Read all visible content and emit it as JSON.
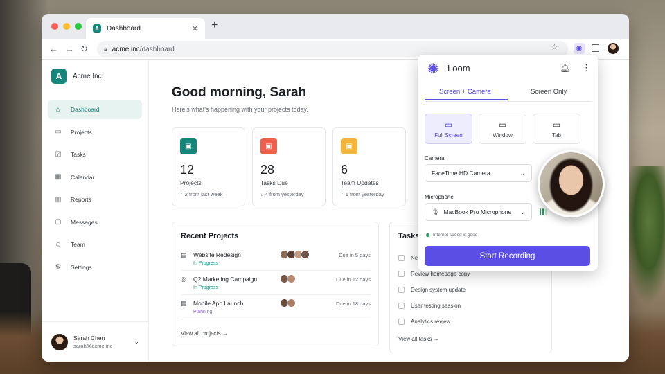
{
  "colors": {
    "brand": "#16857a",
    "loom_accent": "#5b4ee5",
    "stat_projects": "#16857a",
    "stat_tasks": "#ef5f4e",
    "stat_updates": "#f2b43a",
    "status_in_progress": "#1f9d84",
    "status_planning": "#8a63d2",
    "delta_up": "#1e9e5b",
    "delta_down": "#e2553f"
  },
  "browser": {
    "tab_title": "Dashboard",
    "favicon": "A",
    "url_host": "acme.inc",
    "url_path": "/dashboard"
  },
  "sidebar": {
    "brand_letter": "A",
    "brand_name": "Acme Inc.",
    "items": [
      {
        "label": "Dashboard",
        "icon": "home-icon"
      },
      {
        "label": "Projects",
        "icon": "folder-icon"
      },
      {
        "label": "Tasks",
        "icon": "checkbox-icon"
      },
      {
        "label": "Calendar",
        "icon": "calendar-icon"
      },
      {
        "label": "Reports",
        "icon": "bar-chart-icon"
      },
      {
        "label": "Messages",
        "icon": "chat-icon"
      },
      {
        "label": "Team",
        "icon": "users-icon"
      },
      {
        "label": "Settings",
        "icon": "gear-icon"
      }
    ],
    "user": {
      "name": "Sarah Chen",
      "email": "sarah@acme.inc"
    }
  },
  "main": {
    "greeting": "Good morning, Sarah",
    "subtitle": "Here's what's happening with your projects today.",
    "stats": [
      {
        "value": "12",
        "label": "Projects",
        "delta": "2 from last week",
        "direction": "up"
      },
      {
        "value": "28",
        "label": "Tasks Due",
        "delta": "4 from yesterday",
        "direction": "down"
      },
      {
        "value": "6",
        "label": "Team Updates",
        "delta": "1 from yesterday",
        "direction": "up"
      }
    ],
    "recent_projects": {
      "title": "Recent Projects",
      "items": [
        {
          "name": "Website Redesign",
          "status": "In Progress",
          "due": "Due in 5 days"
        },
        {
          "name": "Q2 Marketing Campaign",
          "status": "In Progress",
          "due": "Due in 12 days"
        },
        {
          "name": "Mobile App Launch",
          "status": "Planning",
          "due": "Due in 18 days"
        }
      ],
      "view_all": "View all projects"
    },
    "tasks": {
      "title": "Tasks",
      "items": [
        "Ne",
        "Review homepage copy",
        "Design system update",
        "User testing session",
        "Analytics review"
      ],
      "view_all": "View all tasks"
    }
  },
  "loom": {
    "name": "Loom",
    "tabs": [
      "Screen + Camera",
      "Screen Only"
    ],
    "active_tab": 0,
    "modes": [
      "Full Screen",
      "Window",
      "Tab"
    ],
    "active_mode": 0,
    "camera_label": "Camera",
    "camera_value": "FaceTime HD Camera",
    "microphone_label": "Microphone",
    "microphone_value": "MacBook Pro Microphone",
    "speed_note": "Internet speed is good",
    "record_button": "Start Recording"
  }
}
